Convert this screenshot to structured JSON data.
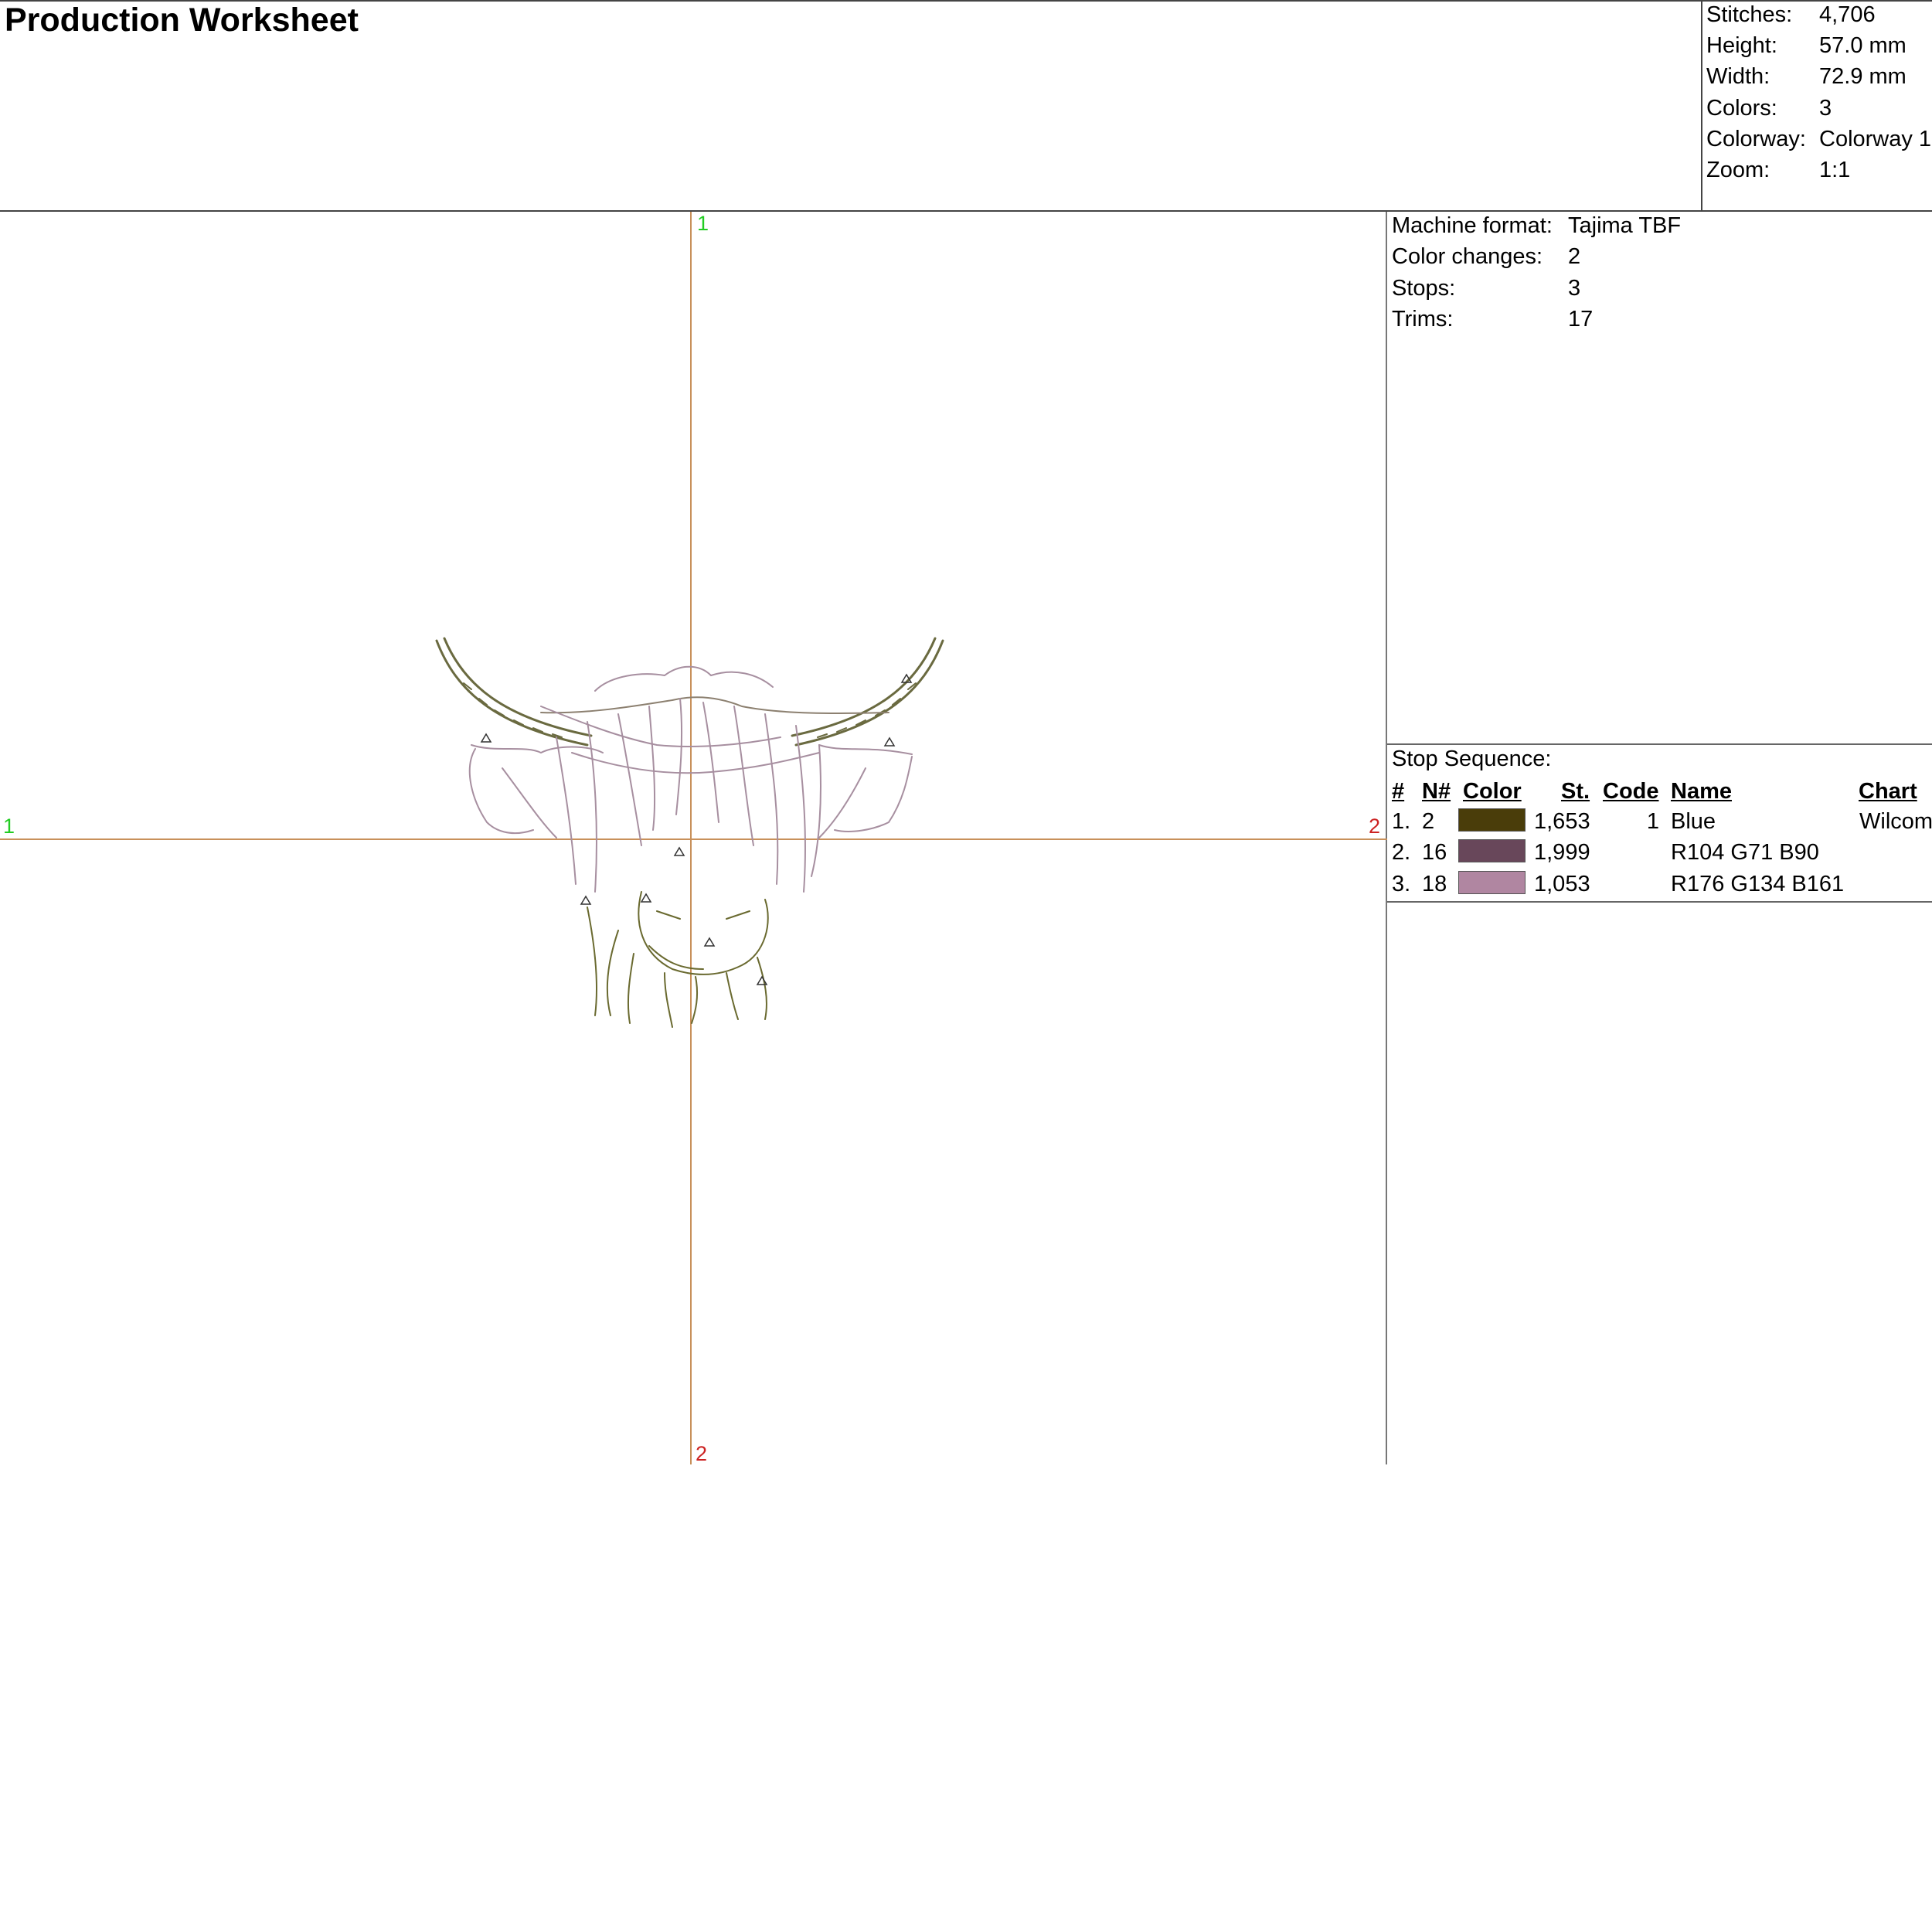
{
  "title": "Production Worksheet",
  "summary": [
    {
      "label": "Stitches:",
      "value": "4,706"
    },
    {
      "label": "Height:",
      "value": "57.0 mm"
    },
    {
      "label": "Width:",
      "value": "72.9 mm"
    },
    {
      "label": "Colors:",
      "value": "3"
    },
    {
      "label": "Colorway:",
      "value": "Colorway 1"
    },
    {
      "label": "Zoom:",
      "value": "1:1"
    }
  ],
  "machine": [
    {
      "label": "Machine format:",
      "value": "Tajima TBF"
    },
    {
      "label": "Color changes:",
      "value": "2"
    },
    {
      "label": "Stops:",
      "value": "3"
    },
    {
      "label": "Trims:",
      "value": "17"
    }
  ],
  "axis_labels": {
    "top": "1",
    "left": "1",
    "right": "2",
    "bottom": "2"
  },
  "colors": {
    "axis": "#c8905a",
    "axis_start": "#22cc22",
    "axis_end": "#cc2222"
  },
  "stop_sequence": {
    "title": "Stop Sequence:",
    "headers": [
      "#",
      "N#",
      "Color",
      "St.",
      "Code",
      "Name",
      "Chart"
    ],
    "rows": [
      {
        "num": "1.",
        "n": "2",
        "color": "#4a3d0a",
        "stitches": "1,653",
        "code": "1",
        "name": "Blue",
        "chart": "Wilcom"
      },
      {
        "num": "2.",
        "n": "16",
        "color": "#68475a",
        "stitches": "1,999",
        "code": "",
        "name": "R104 G71 B90",
        "chart": ""
      },
      {
        "num": "3.",
        "n": "18",
        "color": "#b086a1",
        "stitches": "1,053",
        "code": "",
        "name": "R176 G134 B161",
        "chart": ""
      }
    ]
  }
}
